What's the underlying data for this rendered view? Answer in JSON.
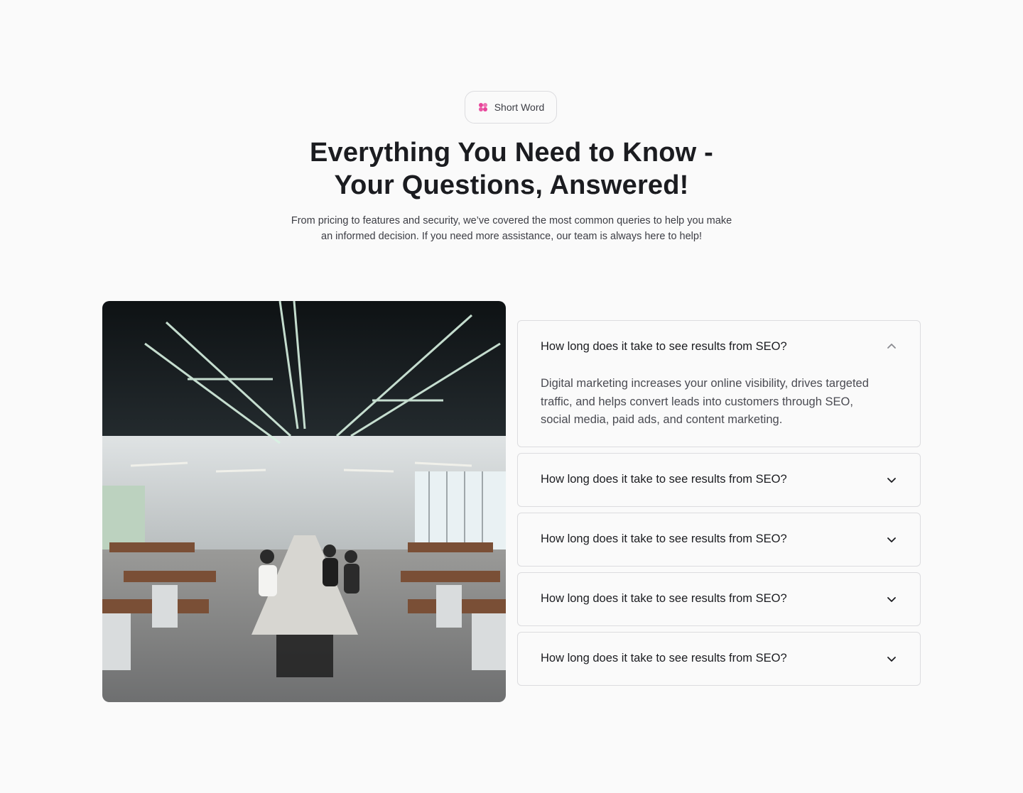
{
  "badge": {
    "label": "Short Word",
    "icon": "flower-icon",
    "icon_color": "#e8449a"
  },
  "headline": {
    "line1": "Everything You Need to Know -",
    "line2": "Your Questions, Answered!"
  },
  "subtitle": {
    "line1": "From pricing to features and security, we’ve covered the most common queries to help you make",
    "line2": "an informed decision. If you need more assistance, our team is always here to help!"
  },
  "image": {
    "subject": "office-photo"
  },
  "faq": {
    "items": [
      {
        "question": "How long does it take to see results from SEO?",
        "answer": "Digital marketing increases your online visibility, drives targeted traffic, and helps convert leads into customers through SEO, social media, paid ads, and content marketing.",
        "expanded": true
      },
      {
        "question": "How long does it take to see results from SEO?",
        "expanded": false
      },
      {
        "question": "How long does it take to see results from SEO?",
        "expanded": false
      },
      {
        "question": "How long does it take to see results from SEO?",
        "expanded": false
      },
      {
        "question": "How long does it take to see results from SEO?",
        "expanded": false
      }
    ]
  },
  "colors": {
    "background": "#fafafa",
    "text": "#1b1c20",
    "border": "#dcdcdf",
    "accent": "#e8449a"
  }
}
